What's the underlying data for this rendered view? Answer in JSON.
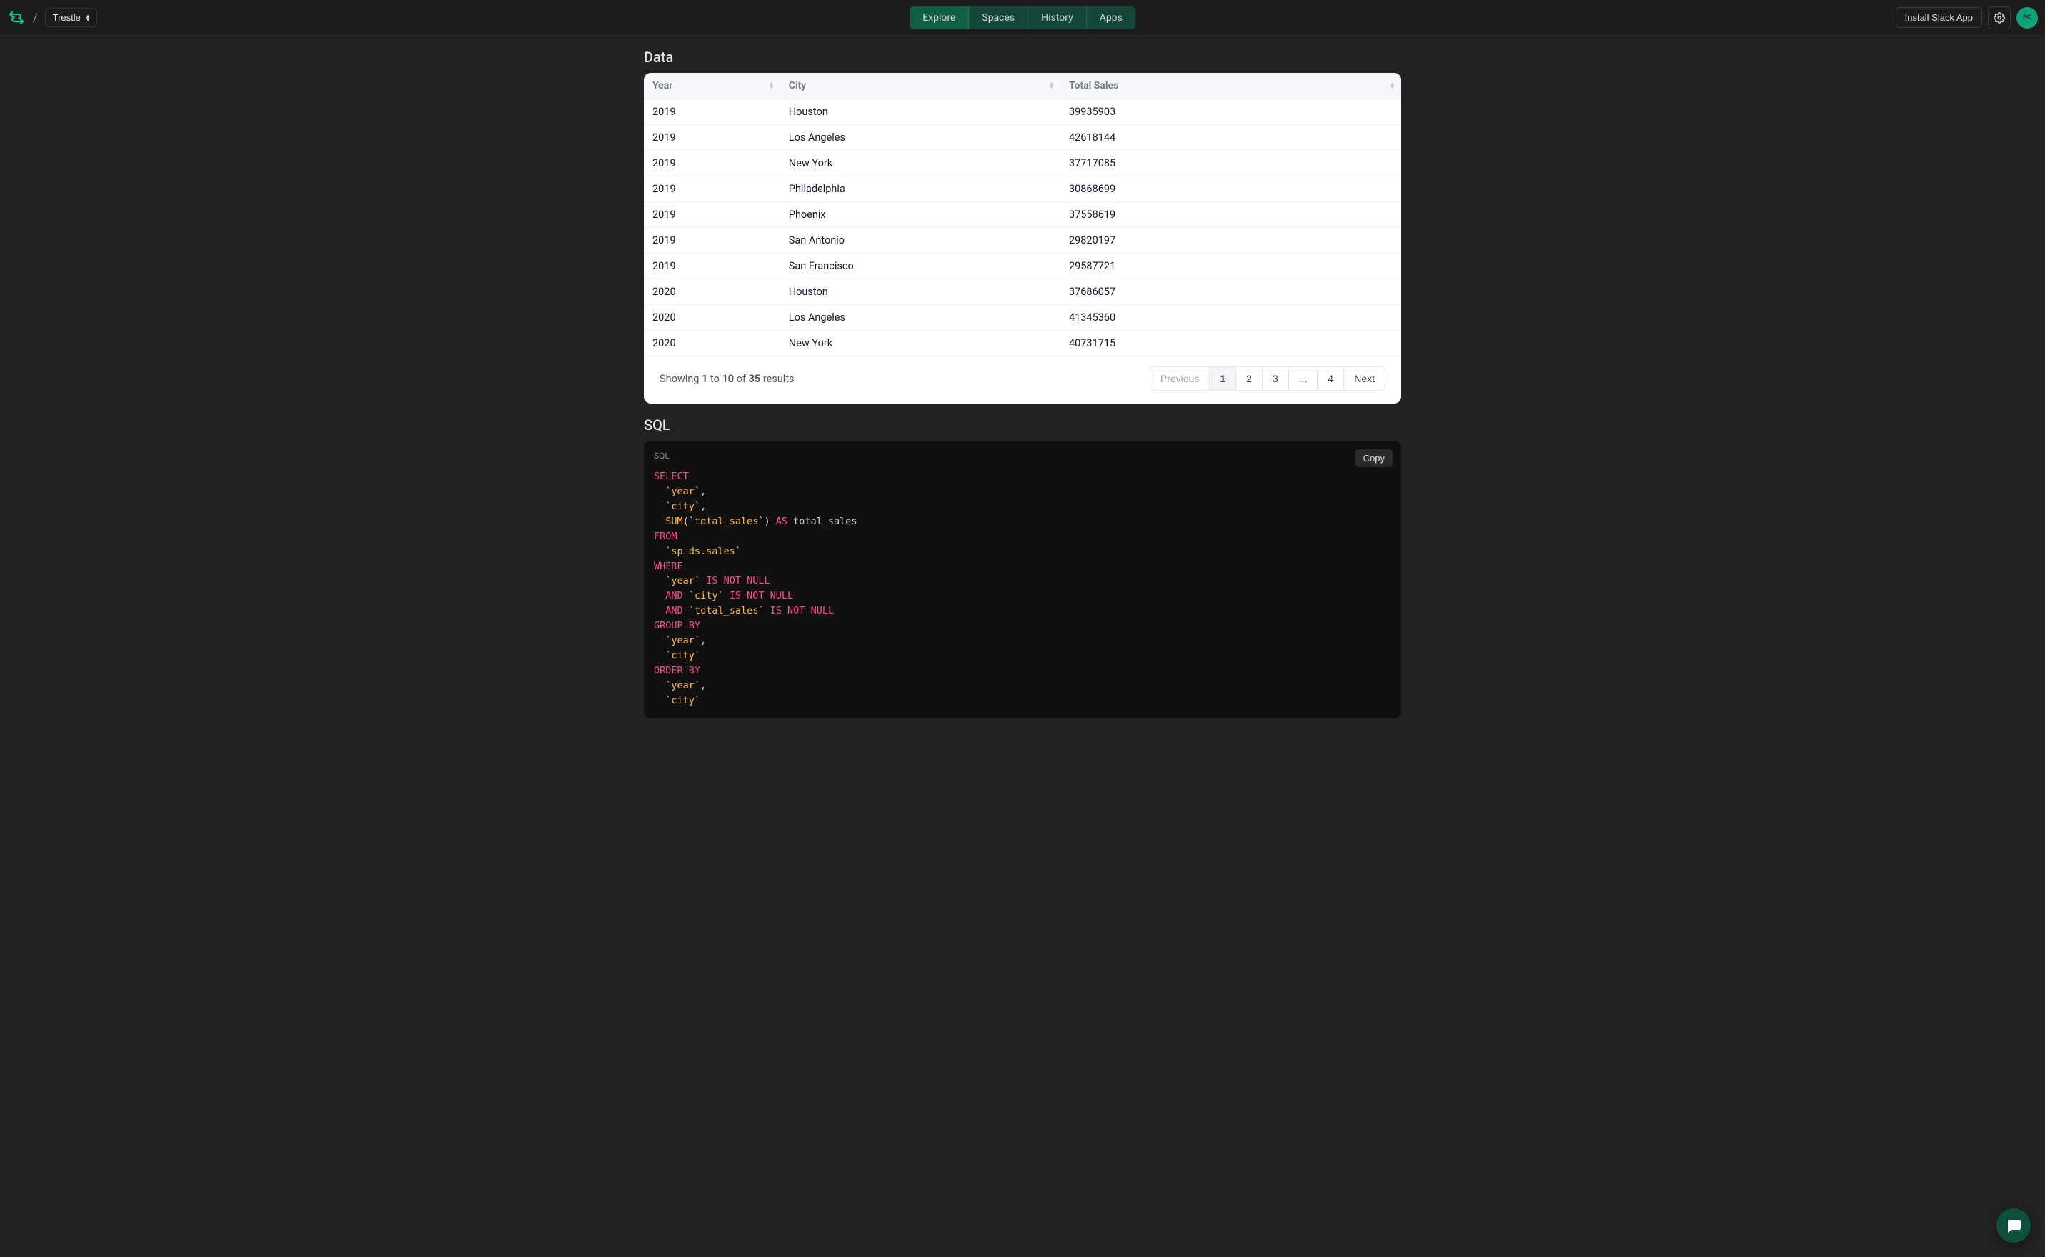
{
  "header": {
    "workspace": "Trestle",
    "nav": [
      {
        "label": "Explore",
        "active": true
      },
      {
        "label": "Spaces",
        "active": false
      },
      {
        "label": "History",
        "active": false
      },
      {
        "label": "Apps",
        "active": false
      }
    ],
    "install_btn": "Install Slack App",
    "avatar_initials": "BC"
  },
  "data_section": {
    "title": "Data",
    "columns": [
      "Year",
      "City",
      "Total Sales"
    ],
    "rows": [
      {
        "year": "2019",
        "city": "Houston",
        "total_sales": "39935903"
      },
      {
        "year": "2019",
        "city": "Los Angeles",
        "total_sales": "42618144"
      },
      {
        "year": "2019",
        "city": "New York",
        "total_sales": "37717085"
      },
      {
        "year": "2019",
        "city": "Philadelphia",
        "total_sales": "30868699"
      },
      {
        "year": "2019",
        "city": "Phoenix",
        "total_sales": "37558619"
      },
      {
        "year": "2019",
        "city": "San Antonio",
        "total_sales": "29820197"
      },
      {
        "year": "2019",
        "city": "San Francisco",
        "total_sales": "29587721"
      },
      {
        "year": "2020",
        "city": "Houston",
        "total_sales": "37686057"
      },
      {
        "year": "2020",
        "city": "Los Angeles",
        "total_sales": "41345360"
      },
      {
        "year": "2020",
        "city": "New York",
        "total_sales": "40731715"
      }
    ],
    "footer": {
      "showing_prefix": "Showing ",
      "from": "1",
      "to_word": " to ",
      "to": "10",
      "of_word": " of ",
      "total": "35",
      "results_word": " results"
    },
    "pagination": {
      "previous": "Previous",
      "pages": [
        "1",
        "2",
        "3",
        "...",
        "4"
      ],
      "next": "Next",
      "active_index": 0
    }
  },
  "sql_section": {
    "title": "SQL",
    "label": "SQL",
    "copy_btn": "Copy",
    "tokens": [
      [
        "kw",
        "SELECT"
      ],
      [
        "nl"
      ],
      [
        "sp",
        "  "
      ],
      [
        "punc",
        "`"
      ],
      [
        "ident",
        "year"
      ],
      [
        "punc",
        "`"
      ],
      [
        "plain",
        ","
      ],
      [
        "nl"
      ],
      [
        "sp",
        "  "
      ],
      [
        "punc",
        "`"
      ],
      [
        "ident",
        "city"
      ],
      [
        "punc",
        "`"
      ],
      [
        "plain",
        ","
      ],
      [
        "nl"
      ],
      [
        "sp",
        "  "
      ],
      [
        "func",
        "SUM"
      ],
      [
        "punc",
        "("
      ],
      [
        "punc",
        "`"
      ],
      [
        "ident",
        "total_sales"
      ],
      [
        "punc",
        "`"
      ],
      [
        "punc",
        ")"
      ],
      [
        "plain",
        " "
      ],
      [
        "kw",
        "AS"
      ],
      [
        "plain",
        " total_sales"
      ],
      [
        "nl"
      ],
      [
        "kw",
        "FROM"
      ],
      [
        "nl"
      ],
      [
        "sp",
        "  "
      ],
      [
        "punc",
        "`"
      ],
      [
        "ident",
        "sp_ds.sales"
      ],
      [
        "punc",
        "`"
      ],
      [
        "nl"
      ],
      [
        "kw",
        "WHERE"
      ],
      [
        "nl"
      ],
      [
        "sp",
        "  "
      ],
      [
        "punc",
        "`"
      ],
      [
        "ident",
        "year"
      ],
      [
        "punc",
        "`"
      ],
      [
        "plain",
        " "
      ],
      [
        "kw",
        "IS"
      ],
      [
        "plain",
        " "
      ],
      [
        "kw",
        "NOT"
      ],
      [
        "plain",
        " "
      ],
      [
        "kw",
        "NULL"
      ],
      [
        "nl"
      ],
      [
        "sp",
        "  "
      ],
      [
        "kw",
        "AND"
      ],
      [
        "plain",
        " "
      ],
      [
        "punc",
        "`"
      ],
      [
        "ident",
        "city"
      ],
      [
        "punc",
        "`"
      ],
      [
        "plain",
        " "
      ],
      [
        "kw",
        "IS"
      ],
      [
        "plain",
        " "
      ],
      [
        "kw",
        "NOT"
      ],
      [
        "plain",
        " "
      ],
      [
        "kw",
        "NULL"
      ],
      [
        "nl"
      ],
      [
        "sp",
        "  "
      ],
      [
        "kw",
        "AND"
      ],
      [
        "plain",
        " "
      ],
      [
        "punc",
        "`"
      ],
      [
        "ident",
        "total_sales"
      ],
      [
        "punc",
        "`"
      ],
      [
        "plain",
        " "
      ],
      [
        "kw",
        "IS"
      ],
      [
        "plain",
        " "
      ],
      [
        "kw",
        "NOT"
      ],
      [
        "plain",
        " "
      ],
      [
        "kw",
        "NULL"
      ],
      [
        "nl"
      ],
      [
        "kw",
        "GROUP BY"
      ],
      [
        "nl"
      ],
      [
        "sp",
        "  "
      ],
      [
        "punc",
        "`"
      ],
      [
        "ident",
        "year"
      ],
      [
        "punc",
        "`"
      ],
      [
        "plain",
        ","
      ],
      [
        "nl"
      ],
      [
        "sp",
        "  "
      ],
      [
        "punc",
        "`"
      ],
      [
        "ident",
        "city"
      ],
      [
        "punc",
        "`"
      ],
      [
        "nl"
      ],
      [
        "kw",
        "ORDER BY"
      ],
      [
        "nl"
      ],
      [
        "sp",
        "  "
      ],
      [
        "punc",
        "`"
      ],
      [
        "ident",
        "year"
      ],
      [
        "punc",
        "`"
      ],
      [
        "plain",
        ","
      ],
      [
        "nl"
      ],
      [
        "sp",
        "  "
      ],
      [
        "punc",
        "`"
      ],
      [
        "ident",
        "city"
      ],
      [
        "punc",
        "`"
      ]
    ]
  }
}
